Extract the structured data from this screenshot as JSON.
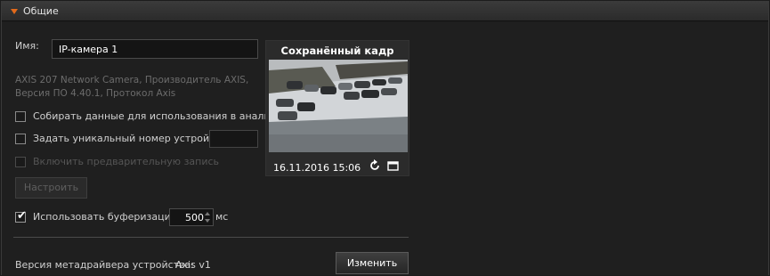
{
  "section": {
    "title": "Общие"
  },
  "name": {
    "label": "Имя:",
    "value": "IP-камера 1"
  },
  "device_info": {
    "line1": "AXIS 207 Network Camera, Производитель AXIS,",
    "line2": "Версия ПО 4.40.1, Протокол Axis"
  },
  "options": {
    "analytics": {
      "label": "Собирать данные для использования в аналитике",
      "checked": false
    },
    "unique_number": {
      "label": "Задать уникальный номер устройства",
      "checked": false,
      "value": ""
    },
    "prerecord": {
      "label": "Включить предварительную запись",
      "checked": false,
      "disabled": true
    },
    "buffering": {
      "label": "Использовать буферизацию",
      "checked": true,
      "value": "500",
      "unit": "мс"
    }
  },
  "buttons": {
    "setup": "Настроить",
    "change": "Изменить"
  },
  "metadriver": {
    "label": "Версия метадрайвера устройства:",
    "value": "Axis v1"
  },
  "preview": {
    "title": "Сохранённый кадр",
    "timestamp": "16.11.2016 15:06"
  },
  "icons": {
    "section_toggle": "triangle-down-icon",
    "refresh": "refresh-icon",
    "window": "window-icon",
    "check": "checkmark-icon"
  },
  "colors": {
    "accent": "#e26a1b",
    "background": "#1f1f1f",
    "text": "#d0d0d0",
    "disabled_text": "#6c6c6c"
  }
}
